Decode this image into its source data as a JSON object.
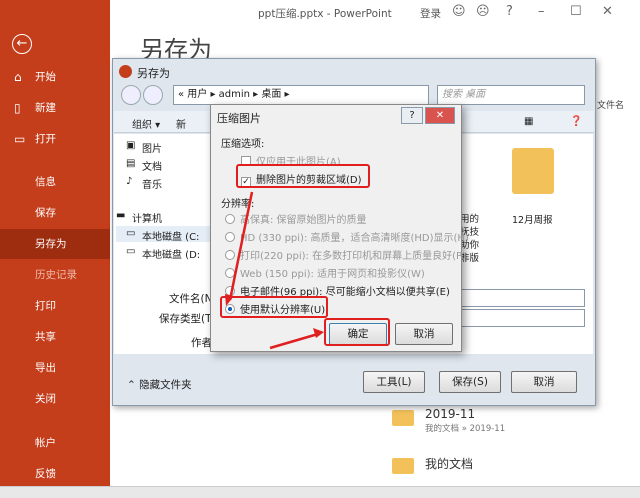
{
  "ppt": {
    "title": "ppt压缩.pptx  -  PowerPoint",
    "login": "登录",
    "page_heading": "另存为",
    "nav": [
      "开始",
      "新建",
      "打开",
      "信息",
      "保存",
      "另存为",
      "历史记录",
      "打印",
      "共享",
      "导出",
      "关闭",
      "帐户",
      "反馈"
    ],
    "recent": [
      {
        "name": "2019-11",
        "sub": "我的文档 » 2019-11"
      },
      {
        "name": "我的文档",
        "sub": ""
      }
    ],
    "bg_fragments": {
      "doc_label": "文件名",
      "drive_lines": [
        "用的",
        "抚技",
        "助你",
        "非版"
      ],
      "file_name": "12月周报"
    }
  },
  "saveas": {
    "title": "另存为",
    "breadcrumb": "« 用户 ▸ admin ▸ 桌面 ▸",
    "search_placeholder": "搜索 桌面",
    "toolbar": {
      "organize": "组织 ▾",
      "new_folder": "新"
    },
    "tree": [
      "图片",
      "文档",
      "音乐",
      "计算机",
      "本地磁盘 (C:",
      "本地磁盘 (D:"
    ],
    "filename_label": "文件名(N):",
    "type_label": "保存类型(T):",
    "author_label": "作者",
    "hide_folders": "隐藏文件夹",
    "tools": "工具(L)",
    "save": "保存(S)",
    "cancel": "取消"
  },
  "compress": {
    "title": "压缩图片",
    "help": "?",
    "close": "✕",
    "section_options": "压缩选项:",
    "opt_only_this": "仅应用于此图片(A)",
    "opt_delete_crop": "删除图片的剪裁区域(D)",
    "section_resolution": "分辨率:",
    "res": [
      "高保真: 保留原始图片的质量",
      "HD (330 ppi): 高质量，适合高清晰度(HD)显示(H)",
      "打印(220 ppi): 在多数打印机和屏幕上质量良好(P)",
      "Web (150 ppi): 适用于网页和投影仪(W)",
      "电子邮件(96 ppi): 尽可能缩小文档以便共享(E)",
      "使用默认分辨率(U)"
    ],
    "ok": "确定",
    "cancel": "取消"
  },
  "colors": {
    "accent": "#c43e1c",
    "highlight": "#e02020"
  }
}
